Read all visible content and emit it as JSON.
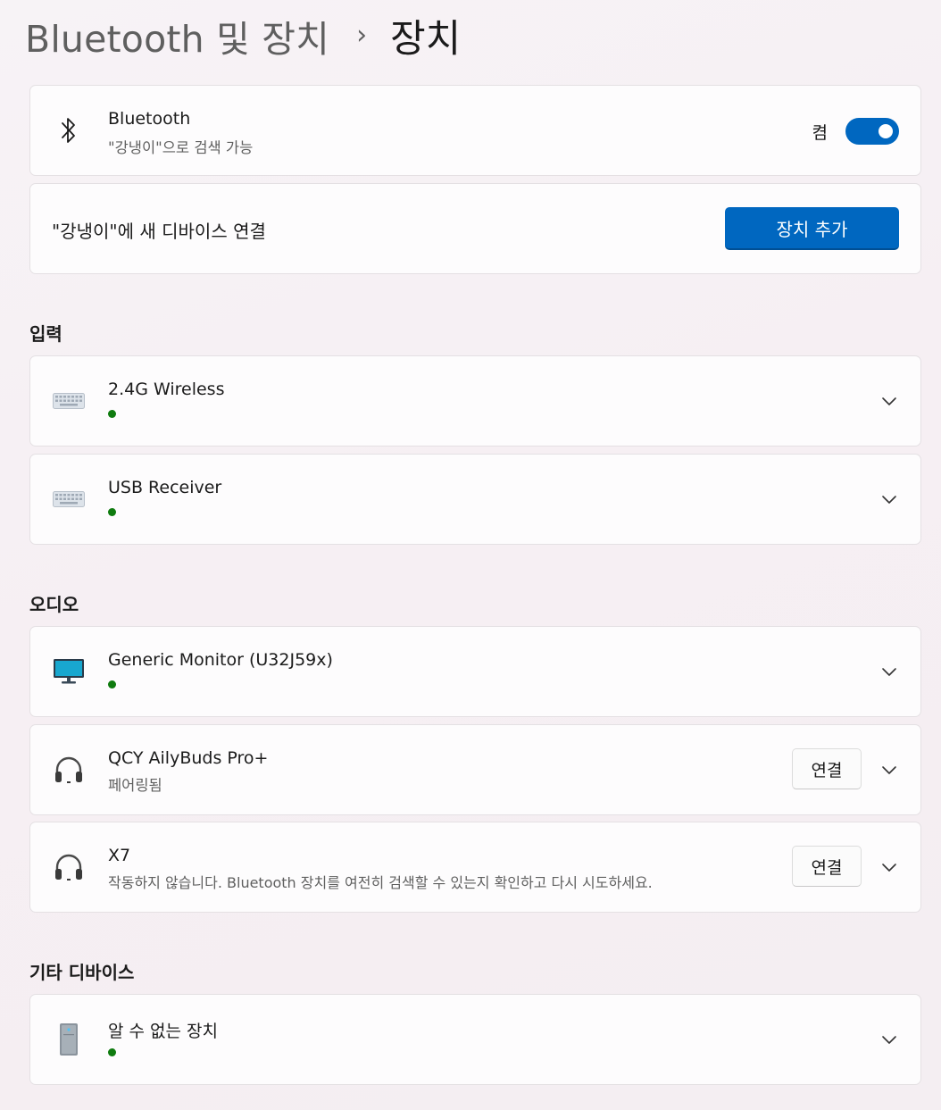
{
  "breadcrumb": {
    "parent": "Bluetooth 및 장치",
    "separator": "›",
    "current": "장치"
  },
  "bluetooth": {
    "title": "Bluetooth",
    "subtitle": "\"강냉이\"으로 검색 가능",
    "toggle_label": "켬",
    "toggle_on": true,
    "icon": "bluetooth-icon"
  },
  "add_device": {
    "text": "\"강냉이\"에 새 디바이스 연결",
    "button_label": "장치 추가"
  },
  "sections": {
    "input": "입력",
    "audio": "오디오",
    "other": "기타 디바이스"
  },
  "input_devices": [
    {
      "name": "2.4G Wireless",
      "status": "connected",
      "icon": "keyboard-icon"
    },
    {
      "name": "USB Receiver",
      "status": "connected",
      "icon": "keyboard-icon"
    }
  ],
  "audio_devices": [
    {
      "name": "Generic Monitor (U32J59x)",
      "status": "connected",
      "icon": "monitor-icon"
    },
    {
      "name": "QCY AilyBuds Pro+",
      "status_text": "페어링됨",
      "connect_label": "연결",
      "icon": "headphones-icon"
    },
    {
      "name": "X7",
      "status_text": "작동하지 않습니다. Bluetooth 장치를 여전히 검색할 수 있는지 확인하고 다시 시도하세요.",
      "connect_label": "연결",
      "icon": "headphones-icon"
    }
  ],
  "other_devices": [
    {
      "name": "알 수 없는 장치",
      "status": "connected",
      "icon": "pc-tower-icon"
    }
  ],
  "colors": {
    "accent": "#0067c0",
    "status_connected": "#0f7b0f"
  }
}
